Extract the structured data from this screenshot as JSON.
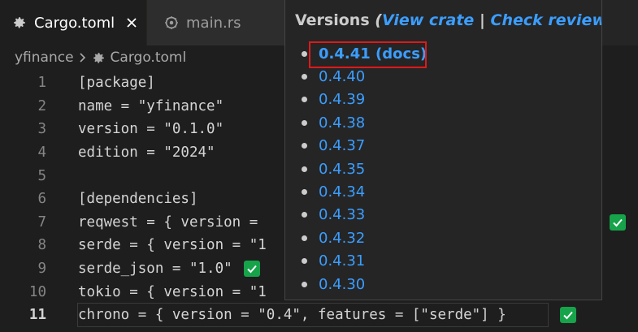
{
  "tabs": [
    {
      "label": "Cargo.toml",
      "icon": "gear-icon",
      "active": true
    },
    {
      "label": "main.rs",
      "icon": "rust-icon",
      "active": false
    }
  ],
  "breadcrumb": {
    "folder": "yfinance",
    "file": "Cargo.toml"
  },
  "editor": {
    "current_line": 11,
    "lines": [
      {
        "n": "1",
        "text": "[package]"
      },
      {
        "n": "2",
        "text": "name = \"yfinance\""
      },
      {
        "n": "3",
        "text": "version = \"0.1.0\""
      },
      {
        "n": "4",
        "text": "edition = \"2024\""
      },
      {
        "n": "5",
        "text": ""
      },
      {
        "n": "6",
        "text": "[dependencies]"
      },
      {
        "n": "7",
        "text": "reqwest = { version = "
      },
      {
        "n": "8",
        "text": "serde = { version = \"1"
      },
      {
        "n": "9",
        "text": "serde_json = \"1.0\""
      },
      {
        "n": "10",
        "text": "tokio = { version = \"1"
      },
      {
        "n": "11",
        "text": "chrono = { version = \"0.4\", features = [\"serde\"] }"
      }
    ]
  },
  "popup": {
    "title": "Versions",
    "open_paren": "(",
    "view_crate": "View crate",
    "separator": "|",
    "check_reviews": "Check reviews",
    "close_paren": ")",
    "versions": [
      "0.4.41 (docs)",
      "0.4.40",
      "0.4.39",
      "0.4.38",
      "0.4.37",
      "0.4.35",
      "0.4.34",
      "0.4.33",
      "0.4.32",
      "0.4.31",
      "0.4.30"
    ]
  },
  "colors": {
    "accent_link": "#3b9eff",
    "check_green": "#16a34a",
    "highlight_red": "#e01919"
  }
}
